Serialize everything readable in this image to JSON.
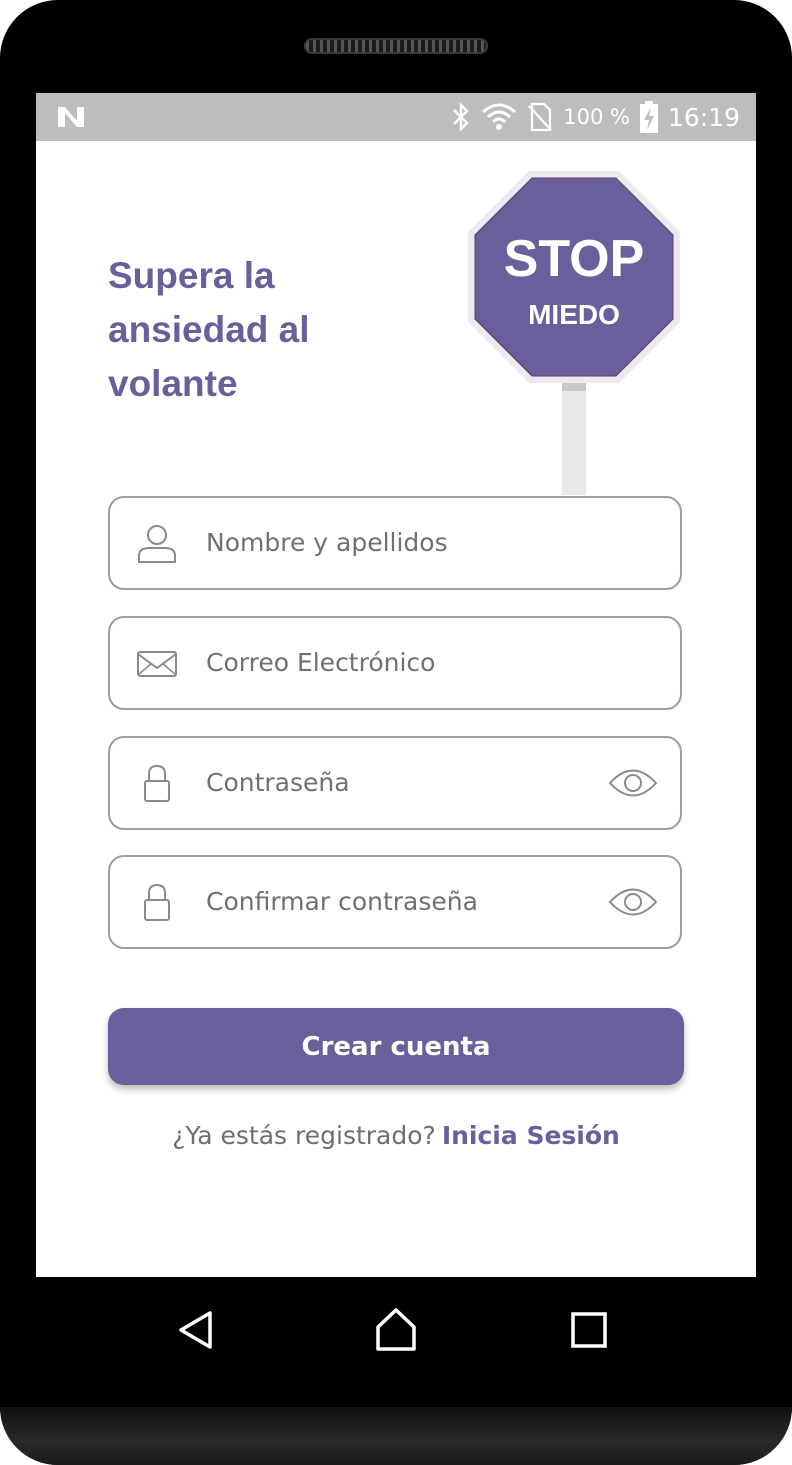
{
  "status_bar": {
    "battery_percent": "100 %",
    "time": "16:19",
    "icons": [
      "n-logo-icon",
      "bluetooth-icon",
      "wifi-icon",
      "no-sim-icon",
      "battery-charging-icon"
    ]
  },
  "header": {
    "headline": "Supera la ansiedad al volante",
    "illustration": {
      "name": "stop-sign-illustration",
      "line1": "STOP",
      "line2": "MIEDO",
      "sign_color": "#6a5f9a"
    }
  },
  "form": {
    "name_placeholder": "Nombre y apellidos",
    "email_placeholder": "Correo Electrónico",
    "password_placeholder": "Contraseña",
    "confirm_password_placeholder": "Confirmar contraseña"
  },
  "actions": {
    "create_account_label": "Crear cuenta",
    "already_registered_text": "¿Ya estás registrado?",
    "login_link": "Inicia Sesión"
  },
  "colors": {
    "accent": "#6a5f9a",
    "field_border": "#9e9e9e",
    "status_bar": "#bdbdbd",
    "frame": "#000000"
  },
  "nav_bar": {
    "buttons": [
      "back-icon",
      "home-icon",
      "recents-icon"
    ]
  }
}
